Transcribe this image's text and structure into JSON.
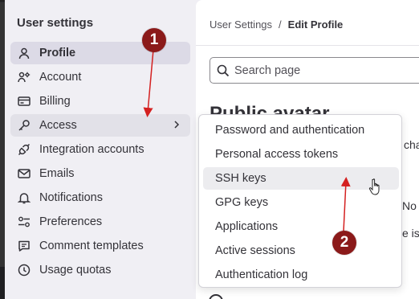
{
  "sidebar": {
    "title": "User settings",
    "items": [
      {
        "label": "Profile",
        "icon": "user-icon"
      },
      {
        "label": "Account",
        "icon": "account-gear-icon"
      },
      {
        "label": "Billing",
        "icon": "credit-card-icon"
      },
      {
        "label": "Access",
        "icon": "key-icon"
      },
      {
        "label": "Integration accounts",
        "icon": "plug-icon"
      },
      {
        "label": "Emails",
        "icon": "mail-icon"
      },
      {
        "label": "Notifications",
        "icon": "bell-icon"
      },
      {
        "label": "Preferences",
        "icon": "preferences-icon"
      },
      {
        "label": "Comment templates",
        "icon": "comment-icon"
      },
      {
        "label": "Usage quotas",
        "icon": "quota-icon"
      }
    ]
  },
  "breadcrumb": {
    "parent": "User Settings",
    "separator": "/",
    "current": "Edit Profile"
  },
  "search": {
    "placeholder": "Search page"
  },
  "main": {
    "heading": "Public avatar",
    "fragments": [
      "cha",
      "No f",
      "e is"
    ]
  },
  "dropdown": {
    "items": [
      "Password and authentication",
      "Personal access tokens",
      "SSH keys",
      "GPG keys",
      "Applications",
      "Active sessions",
      "Authentication log"
    ]
  },
  "annotations": {
    "badge_1": "1",
    "badge_2": "2",
    "color": "#8b1a1a",
    "arrow_color": "#d42020"
  },
  "colors": {
    "sidebar_bg": "#f0eff4",
    "active_item_bg": "#dcdae6",
    "text": "#333238"
  }
}
